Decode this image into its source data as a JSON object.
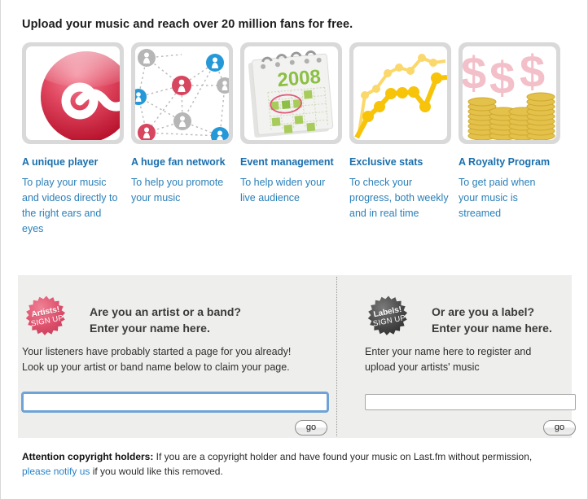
{
  "headline": "Upload your music and reach over 20 million fans for free.",
  "features": [
    {
      "icon": "lastfm-logo-icon",
      "title": "A unique player",
      "desc": "To play your music and videos directly to the right ears and eyes"
    },
    {
      "icon": "fan-network-icon",
      "title": "A huge fan network",
      "desc": "To help you promote your music"
    },
    {
      "icon": "calendar-icon",
      "title": "Event management",
      "desc": "To help widen your live audience",
      "calendar_year": "2008"
    },
    {
      "icon": "line-chart-icon",
      "title": "Exclusive stats",
      "desc": "To check your progress, both weekly and in real time"
    },
    {
      "icon": "money-coins-icon",
      "title": "A Royalty Program",
      "desc": "To get paid when your music is streamed",
      "currency_symbols": "$$$"
    }
  ],
  "signup": {
    "artist": {
      "badge_line1": "Artists!",
      "badge_line2": "SIGN UP",
      "badge_color": "#e0536f",
      "heading_line1": "Are you an artist or a band?",
      "heading_line2": "Enter your name here.",
      "body_line1": "Your listeners have probably started a page for you already!",
      "body_line2": "Look up your artist or band name below to claim your page.",
      "input_value": "",
      "input_placeholder": "",
      "go_label": "go"
    },
    "label": {
      "badge_line1": "Labels!",
      "badge_line2": "SIGN UP",
      "badge_color": "#4a4a4a",
      "heading_line1": "Or are you a label?",
      "heading_line2": "Enter your name here.",
      "body_line1": "Enter your name here to register and",
      "body_line2": "upload your artists' music",
      "input_value": "",
      "input_placeholder": "",
      "go_label": "go"
    }
  },
  "footer": {
    "bold_prefix": "Attention copyright holders:",
    "text_before_link": " If you are a copyright holder and have found your music on Last.fm without permission, ",
    "link_text": "please notify us",
    "text_after_link": " if you would like this removed."
  },
  "colors": {
    "link_blue": "#2a84c8",
    "feature_blue": "#1a6fad",
    "panel_bg": "#eeeeec",
    "page_bg": "#ffffff"
  }
}
